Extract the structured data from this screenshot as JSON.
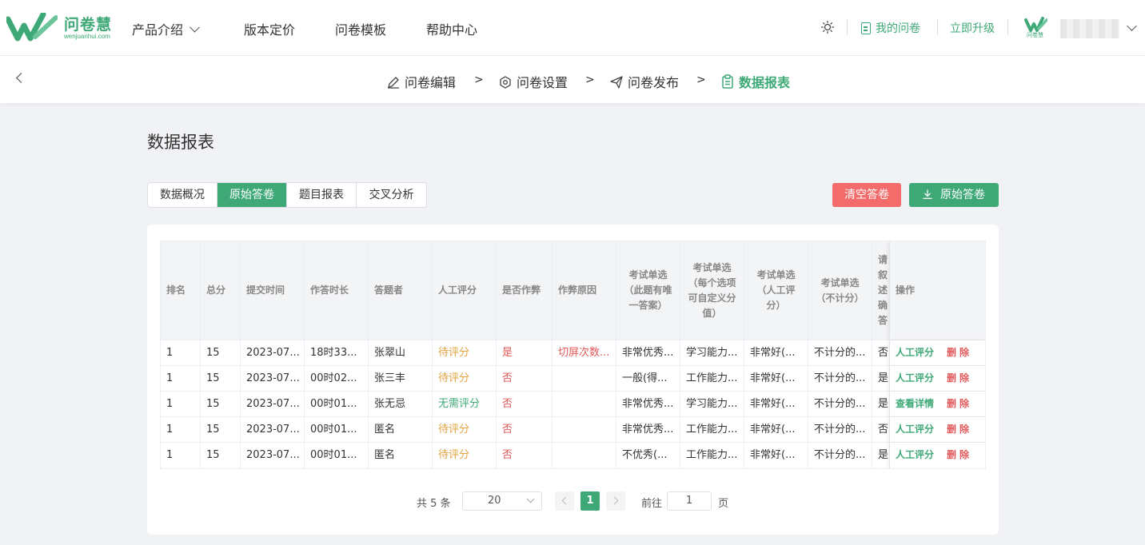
{
  "brand": {
    "name": "问卷慧",
    "domain": "wenjuanhui.com",
    "color": "#3ea977"
  },
  "nav": {
    "items": [
      "产品介绍",
      "版本定价",
      "问卷模板",
      "帮助中心"
    ],
    "my_surveys": "我的问卷",
    "upgrade": "立即升级",
    "small_logo_text": "问卷慧"
  },
  "steps": [
    "问卷编辑",
    "问卷设置",
    "问卷发布",
    "数据报表"
  ],
  "step_separator": ">",
  "page_title": "数据报表",
  "tabs": [
    "数据概况",
    "原始答卷",
    "题目报表",
    "交叉分析"
  ],
  "active_tab": 1,
  "buttons": {
    "clear": "清空答卷",
    "download": "原始答卷"
  },
  "colors": {
    "danger": "#f36b6b",
    "pending": "#e0a13f"
  },
  "table": {
    "headers": [
      "排名",
      "总分",
      "提交时间",
      "作答时长",
      "答题者",
      "人工评分",
      "是否作弊",
      "作弊原因",
      "考试单选（此题有唯一答案）",
      "考试单选（每个选项可自定义分值）",
      "考试单选（人工评分）",
      "考试单选（不计分）",
      "请叙述确答",
      "操作"
    ],
    "rows": [
      {
        "rank": "1",
        "score": "15",
        "time": "2023-07...",
        "duration": "18时33...",
        "name": "张翠山",
        "grade": "待评分",
        "cheat": "是",
        "reason": "切屏次数...",
        "q1": "非常优秀...",
        "q2": "学习能力...",
        "q3": "非常好(...",
        "q4": "不计分的...",
        "q5": "否(",
        "op": "人工评分",
        "del": "删除"
      },
      {
        "rank": "1",
        "score": "15",
        "time": "2023-07...",
        "duration": "00时02...",
        "name": "张三丰",
        "grade": "待评分",
        "cheat": "否",
        "reason": "",
        "q1": "一般(得...",
        "q2": "工作能力...",
        "q3": "非常好(...",
        "q4": "不计分的...",
        "q5": "是(",
        "op": "人工评分",
        "del": "删除"
      },
      {
        "rank": "1",
        "score": "15",
        "time": "2023-07...",
        "duration": "00时01...",
        "name": "张无忌",
        "grade": "无需评分",
        "cheat": "否",
        "reason": "",
        "q1": "非常优秀...",
        "q2": "学习能力...",
        "q3": "非常好(...",
        "q4": "不计分的...",
        "q5": "是(",
        "op": "查看详情",
        "del": "删除"
      },
      {
        "rank": "1",
        "score": "15",
        "time": "2023-07...",
        "duration": "00时01...",
        "name": "匿名",
        "grade": "待评分",
        "cheat": "否",
        "reason": "",
        "q1": "非常优秀...",
        "q2": "工作能力...",
        "q3": "非常好(...",
        "q4": "不计分的...",
        "q5": "否(",
        "op": "人工评分",
        "del": "删除"
      },
      {
        "rank": "1",
        "score": "15",
        "time": "2023-07...",
        "duration": "00时01...",
        "name": "匿名",
        "grade": "待评分",
        "cheat": "否",
        "reason": "",
        "q1": "不优秀(...",
        "q2": "工作能力...",
        "q3": "非常好(...",
        "q4": "不计分的...",
        "q5": "是(",
        "op": "人工评分",
        "del": "删除"
      }
    ]
  },
  "pagination": {
    "total": "共 5 条",
    "page_size": "20",
    "current": "1",
    "goto_label": "前往",
    "goto_value": "1",
    "page_unit": "页"
  }
}
